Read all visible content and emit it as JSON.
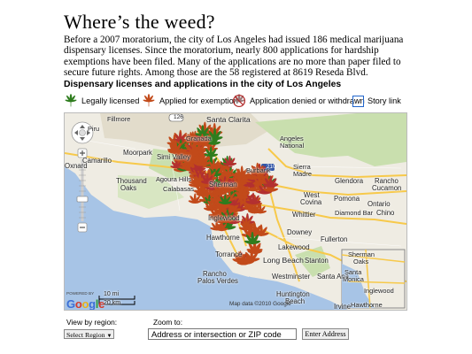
{
  "headline": "Where’s the weed?",
  "intro": "Before a 2007 moratorium, the city of Los Angeles had issued 186 medical marijuana dispensary licenses. Since the moratorium, nearly 800 applications for hardship exemptions have been filed. Many of the applications are no more than paper filed to secure future rights. Among those are the 58 registered at 8619 Reseda Blvd.",
  "subhead": "Dispensary licenses and applications in the city of Los Angeles",
  "legend": {
    "licensed": "Legally licensed",
    "applied": "Applied for exemption",
    "denied": "Application denied or withdrawn",
    "story": "Story link"
  },
  "colors": {
    "licensed": "#2e7d1e",
    "applied": "#c24a1a",
    "denied": "#b33030",
    "story": "#2266cc",
    "land": "#efece3",
    "water": "#a7c4e6",
    "park": "#c9dfae",
    "freeway": "#f7c94a"
  },
  "map": {
    "labels": {
      "santa_clarita": "Santa Clarita",
      "fillmore": "Fillmore",
      "piru": "Piru",
      "granada": "Granada",
      "angeles1": "Angeles",
      "angeles2": "National",
      "camarillo": "Camarillo",
      "moorpark": "Moorpark",
      "simi": "Simi Valley",
      "oxnard": "Oxnard",
      "thousand1": "Thousand",
      "thousand2": "Oaks",
      "agoura": "Agoura Hills",
      "calabasas": "Calabasas",
      "sherman": "Sherman",
      "burbank": "Burbank",
      "sierra1": "Sierra",
      "sierra2": "Madre",
      "glendora": "Glendora",
      "rancho1": "Rancho",
      "rancho2": "Cucamon",
      "west": "West",
      "covina": "Covina",
      "pomona": "Pomona",
      "ontario": "Ontario",
      "whittier": "Whittier",
      "diamond": "Diamond Bar",
      "chino": "Chino",
      "hawthorne": "Hawthorne",
      "downey": "Downey",
      "fullerton": "Fullerton",
      "torrance": "Torrance",
      "long_beach": "Long Beach",
      "stanton": "Stanton",
      "rancho_pv1": "Rancho",
      "rancho_pv2": "Palos Verdes",
      "westminster": "Westminster",
      "santa_ana": "Santa Ana",
      "irvine": "Irvine",
      "lakewood": "Lakewood",
      "huntington1": "Huntington",
      "huntington2": "Beach",
      "inset_sherman1": "Sherman",
      "inset_sherman2": "Oaks",
      "inset_santa1": "Santa",
      "inset_santa2": "Monica",
      "inset_inglewood": "Inglewood",
      "inset_hawthorne": "Hawthorne",
      "inglewood": "Inglewood",
      "hwy_126": "126",
      "hwy_210": "210"
    },
    "credit": "Map data ©2010 Google",
    "google": "Google",
    "powered": "POWERED BY",
    "scale_mi": "10 mi",
    "scale_km": "20 km"
  },
  "controls": {
    "region_label": "View by region:",
    "region_value": "Select Region",
    "zoom_label": "Zoom to:",
    "zoom_placeholder": "Address or intersection or ZIP code",
    "zoom_button": "Enter Address"
  }
}
